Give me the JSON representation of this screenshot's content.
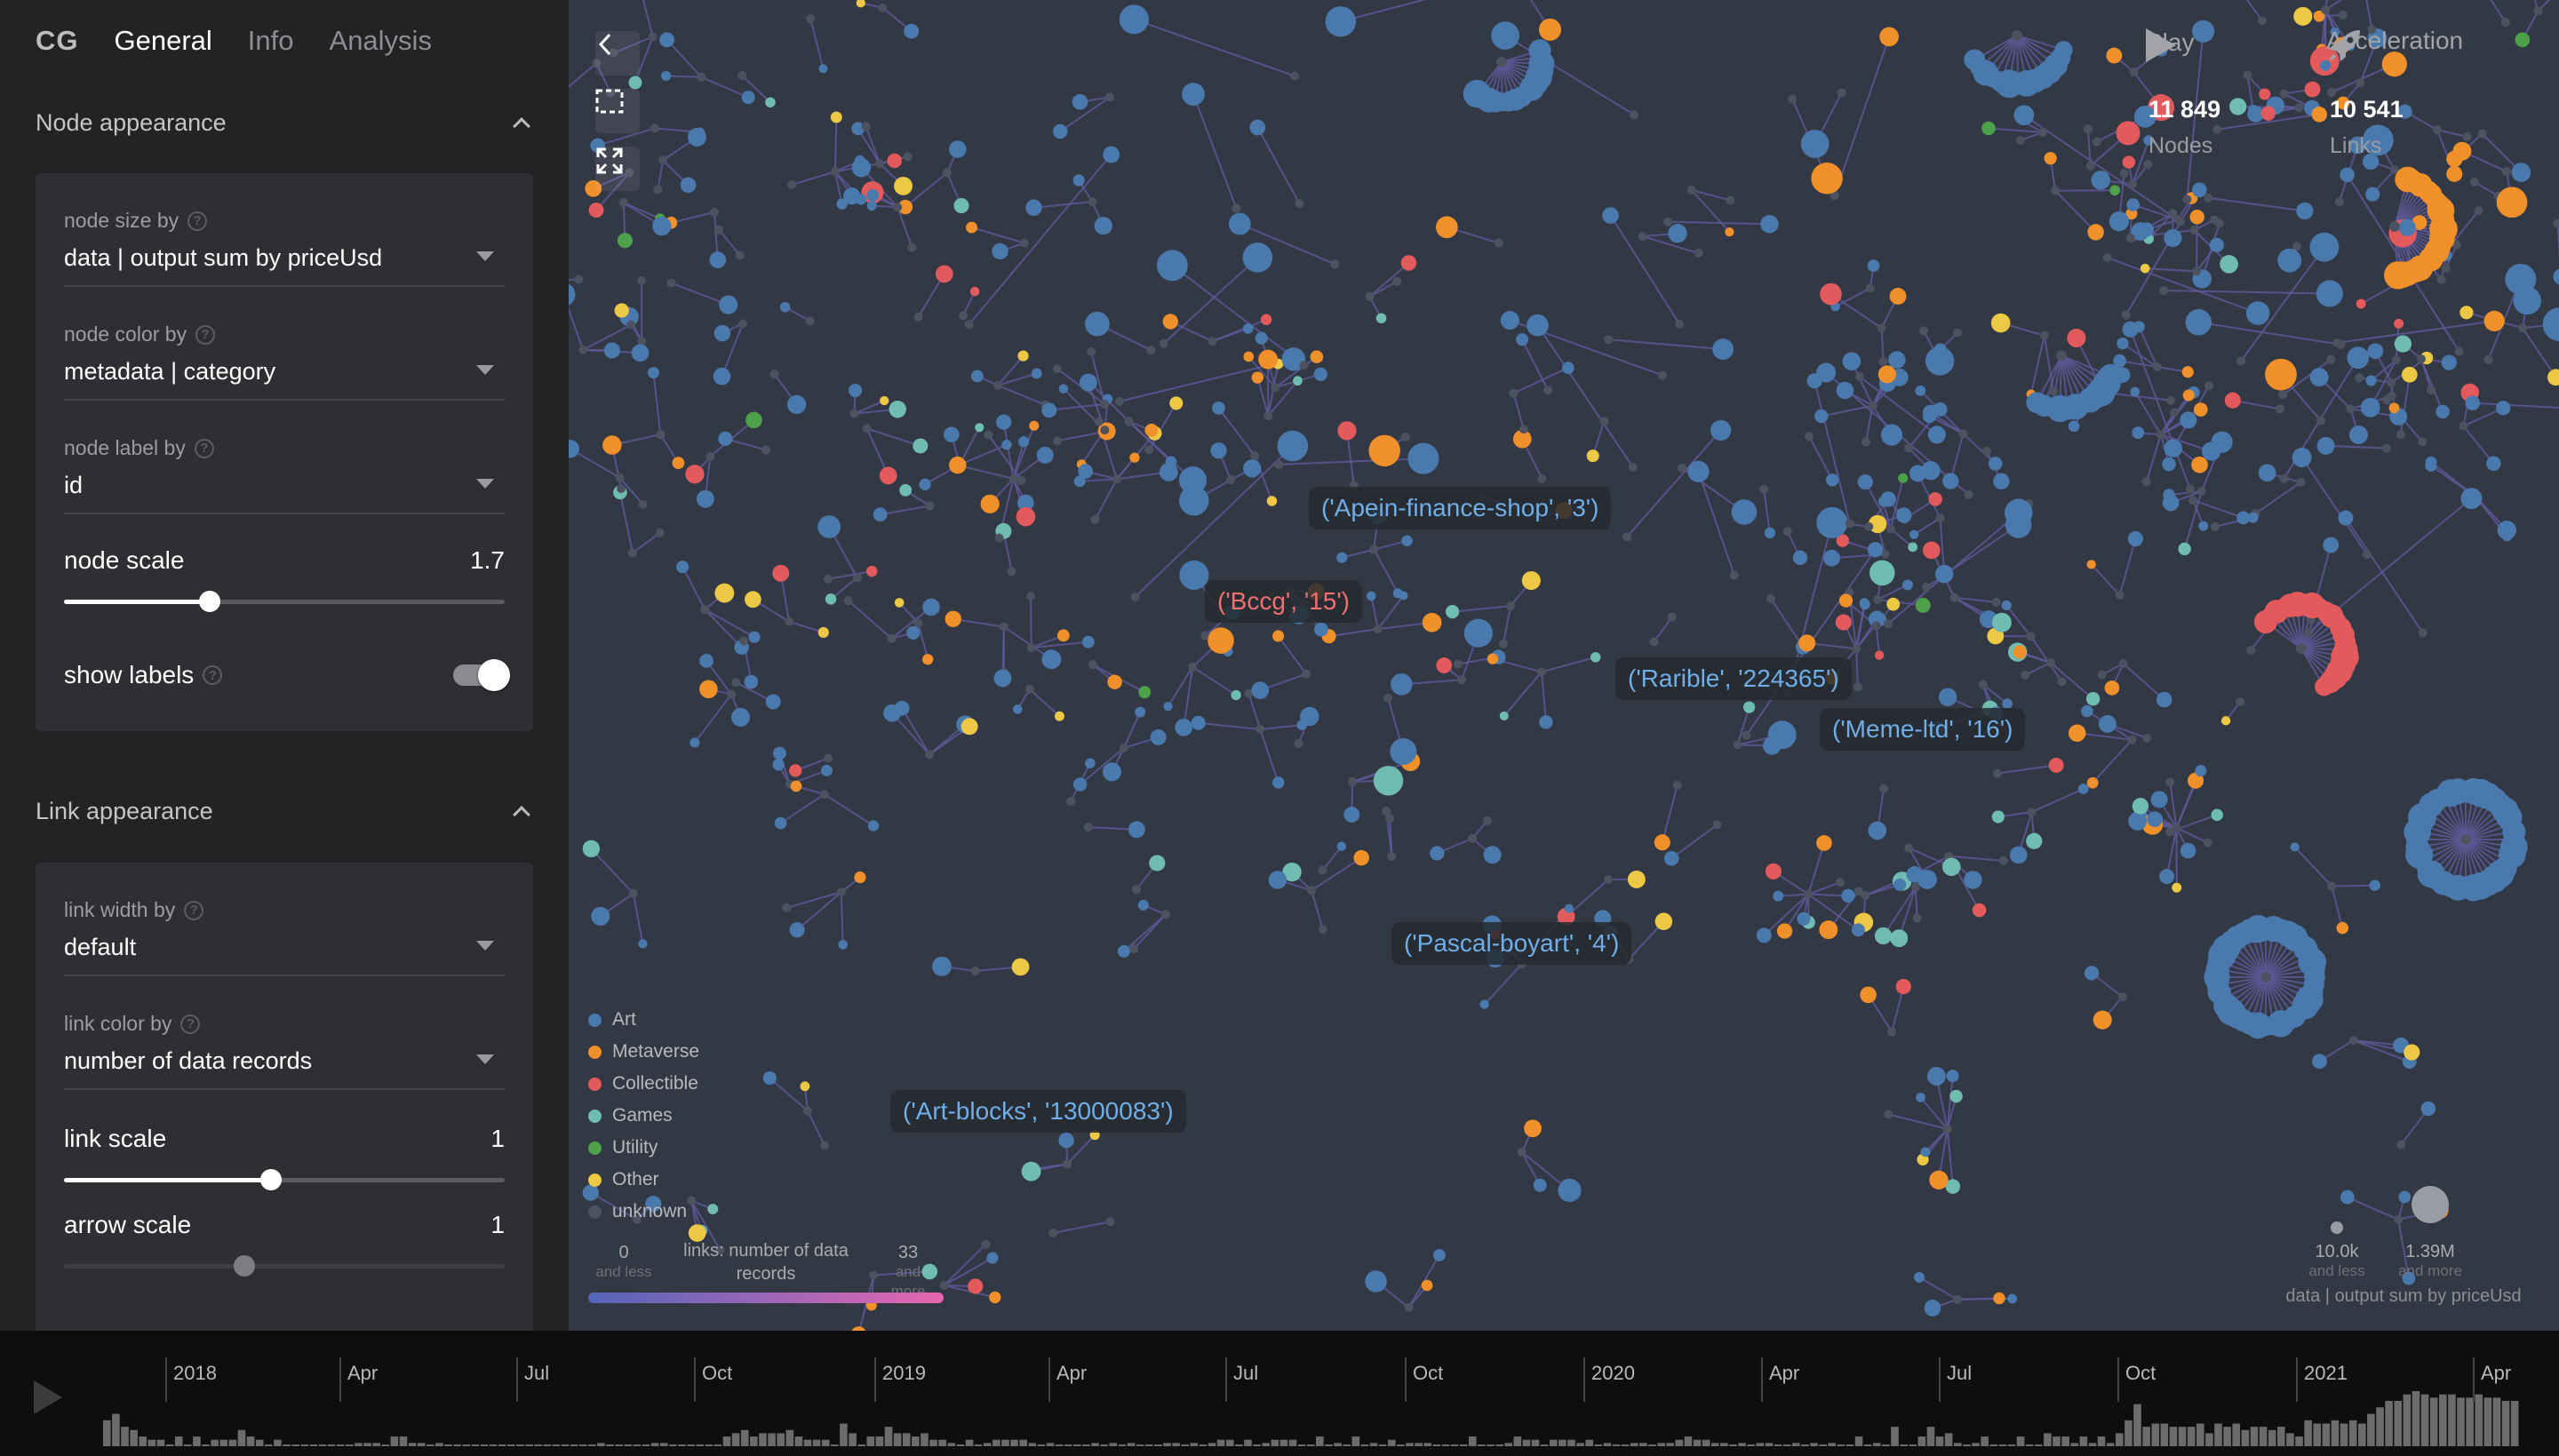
{
  "app": {
    "logo": "CG",
    "tabs": [
      {
        "label": "General",
        "active": true
      },
      {
        "label": "Info",
        "active": false
      },
      {
        "label": "Analysis",
        "active": false
      }
    ]
  },
  "node_appearance": {
    "title": "Node appearance",
    "size_by": {
      "label": "node size by",
      "value": "data | output sum by priceUsd"
    },
    "color_by": {
      "label": "node color by",
      "value": "metadata | category"
    },
    "label_by": {
      "label": "node label by",
      "value": "id"
    },
    "node_scale": {
      "label": "node scale",
      "value": "1.7",
      "fraction": 0.33
    },
    "show_labels": {
      "label": "show labels",
      "on": true
    }
  },
  "link_appearance": {
    "title": "Link appearance",
    "width_by": {
      "label": "link width by",
      "value": "default"
    },
    "color_by": {
      "label": "link color by",
      "value": "number of data records"
    },
    "link_scale": {
      "label": "link scale",
      "value": "1",
      "fraction": 0.47
    },
    "arrow_scale": {
      "label": "arrow scale",
      "value": "1",
      "fraction": 0.41
    }
  },
  "controls": {
    "play_label": "Play",
    "acceleration_label": "Acceleration",
    "nodes_count": "11 849",
    "nodes_label": "Nodes",
    "links_count": "10 541",
    "links_label": "Links"
  },
  "colors": {
    "Art": "#4a79ad",
    "Metaverse": "#f0902a",
    "Collectible": "#e35a5c",
    "Games": "#6fbcb0",
    "Utility": "#4ea14b",
    "Other": "#ecc844",
    "unknown": "#4d5260",
    "link": "#5f5a9c",
    "label_blue": "#6faee8",
    "label_red": "#f07070"
  },
  "legend": {
    "categories": [
      "Art",
      "Metaverse",
      "Collectible",
      "Games",
      "Utility",
      "Other",
      "unknown"
    ],
    "link_scale": {
      "title": "links: number of data records",
      "min": "0",
      "min_note": "and less",
      "max": "33",
      "max_note": "and more"
    },
    "size_scale": {
      "title": "data | output sum by priceUsd",
      "min": "10.0k",
      "min_note": "and less",
      "max": "1.39M",
      "max_note": "and more"
    }
  },
  "node_labels": [
    {
      "text": "('Apein-finance-shop', '3')",
      "color": "blue"
    },
    {
      "text": "('Bccg', '15')",
      "color": "red"
    },
    {
      "text": "('Rarible', '224365')",
      "color": "blue"
    },
    {
      "text": "('Meme-ltd', '16')",
      "color": "blue"
    },
    {
      "text": "('Pascal-boyart', '4')",
      "color": "blue"
    },
    {
      "text": "('Art-blocks', '13000083')",
      "color": "blue"
    }
  ],
  "timeline": {
    "ticks": [
      "2018",
      "Apr",
      "Jul",
      "Oct",
      "2019",
      "Apr",
      "Jul",
      "Oct",
      "2020",
      "Apr",
      "Jul",
      "Oct",
      "2021",
      "Apr"
    ],
    "weekly_activity": [
      8,
      10,
      6,
      5,
      3,
      2,
      2,
      0,
      3,
      0,
      3,
      0,
      2,
      2,
      2,
      5,
      3,
      2,
      0,
      2,
      0,
      0,
      0,
      0,
      0,
      0,
      0,
      0,
      1,
      1,
      1,
      0,
      3,
      3,
      1,
      1,
      0,
      1,
      0,
      0,
      0,
      0,
      0,
      0,
      0,
      0,
      0,
      0,
      0,
      0,
      0,
      0,
      0,
      0,
      0,
      1,
      0,
      0,
      0,
      0,
      0,
      1,
      1,
      0,
      0,
      0,
      0,
      0,
      0,
      3,
      4,
      5,
      3,
      4,
      4,
      4,
      5,
      3,
      2,
      2,
      2,
      0,
      7,
      4,
      0,
      3,
      3,
      6,
      4,
      4,
      3,
      4,
      2,
      2,
      1,
      0,
      2,
      0,
      1,
      2,
      2,
      2,
      2,
      1,
      0,
      1,
      0,
      0,
      0,
      0,
      1,
      0,
      1,
      0,
      1,
      0,
      0,
      0,
      1,
      1,
      0,
      1,
      0,
      1,
      2,
      2,
      0,
      2,
      0,
      1,
      2,
      2,
      2,
      0,
      0,
      3,
      0,
      1,
      0,
      3,
      0,
      1,
      0,
      2,
      0,
      1,
      1,
      1,
      0,
      0,
      0,
      0,
      3,
      0,
      0,
      0,
      1,
      3,
      2,
      2,
      0,
      2,
      2,
      2,
      1,
      2,
      0,
      1,
      0,
      0,
      1,
      1,
      0,
      1,
      1,
      2,
      3,
      2,
      2,
      1,
      1,
      0,
      1,
      0,
      1,
      1,
      0,
      0,
      1,
      0,
      1,
      0,
      1,
      0,
      0,
      3,
      0,
      1,
      0,
      6,
      0,
      0,
      3,
      6,
      3,
      4,
      1,
      0,
      1,
      3,
      0,
      0,
      0,
      3,
      0,
      0,
      4,
      3,
      3,
      1,
      3,
      1,
      3,
      1,
      4,
      8,
      13,
      6,
      7,
      7,
      6,
      6,
      6,
      7,
      4,
      7,
      6,
      7,
      5,
      6,
      6,
      5,
      6,
      4,
      3,
      8,
      7,
      7,
      8,
      7,
      8,
      7,
      10,
      12,
      14,
      14,
      16,
      17,
      16,
      15,
      16,
      16,
      15,
      15,
      16,
      15,
      15,
      14,
      14
    ]
  }
}
